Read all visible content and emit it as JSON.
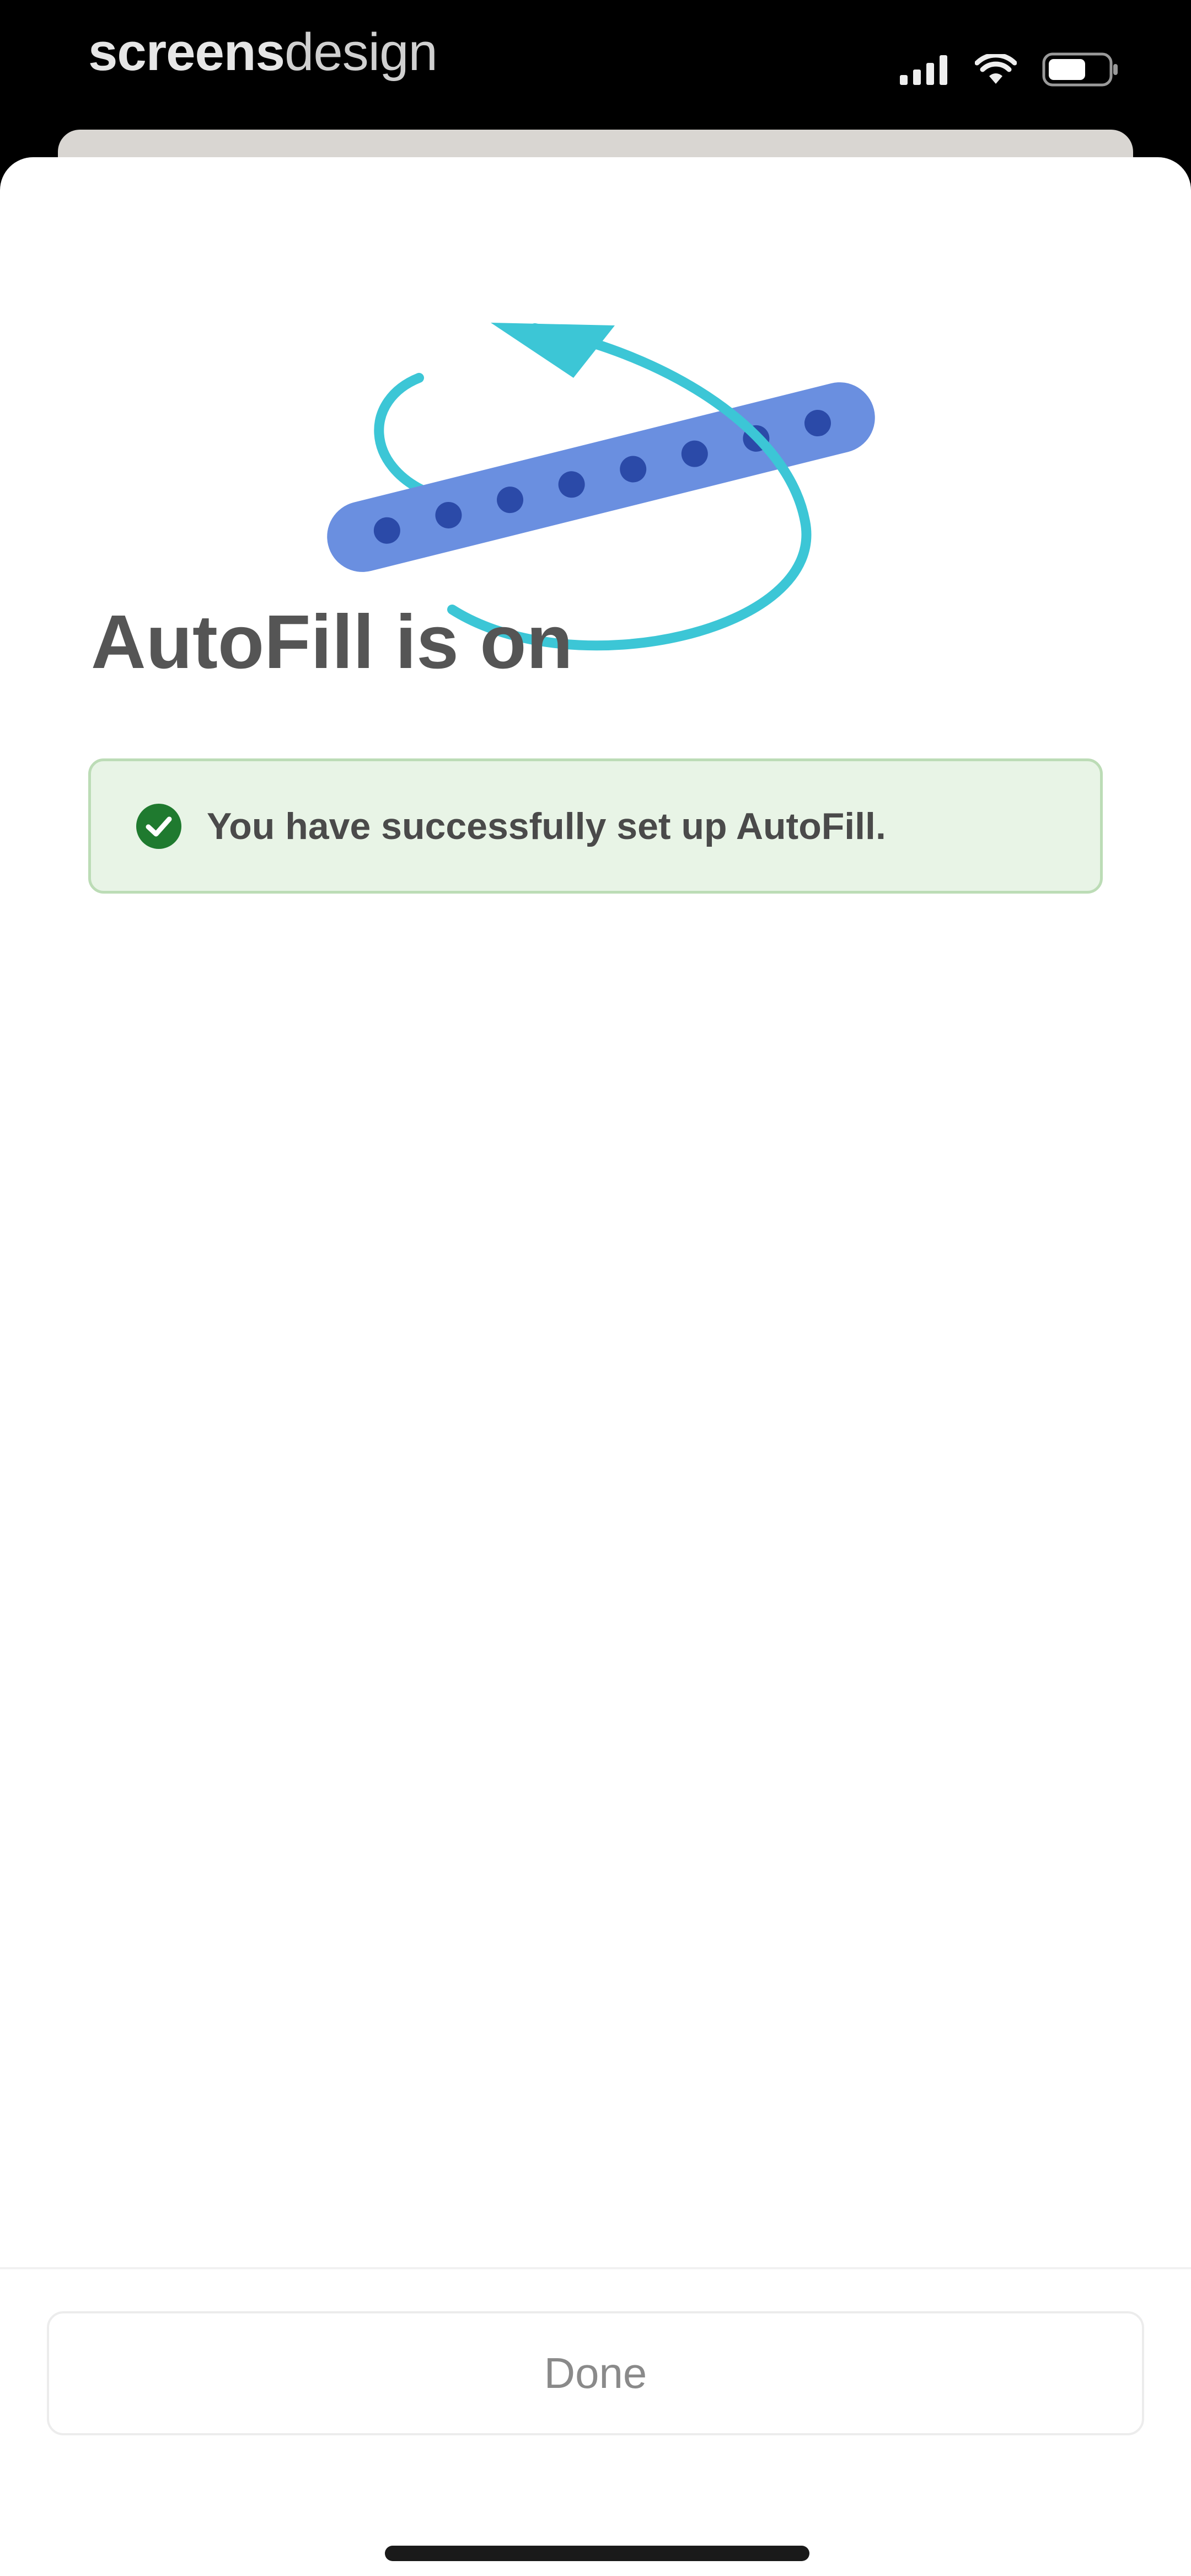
{
  "status_bar": {
    "watermark_bold": "screens",
    "watermark_light": "design",
    "signal_icon": "cellular-signal-icon",
    "wifi_icon": "wifi-icon",
    "battery_icon": "battery-icon"
  },
  "illustration": {
    "icon": "password-rotation-icon",
    "colors": {
      "bar": "#6a8fe0",
      "dots": "#2b4aa8",
      "arrow": "#3cc6d6"
    }
  },
  "main": {
    "title": "AutoFill is on",
    "banner": {
      "icon": "check-circle-icon",
      "text": "You have successfully set up AutoFill.",
      "background": "#e8f4e6",
      "icon_color": "#1f7a2f"
    }
  },
  "footer": {
    "done_label": "Done"
  }
}
